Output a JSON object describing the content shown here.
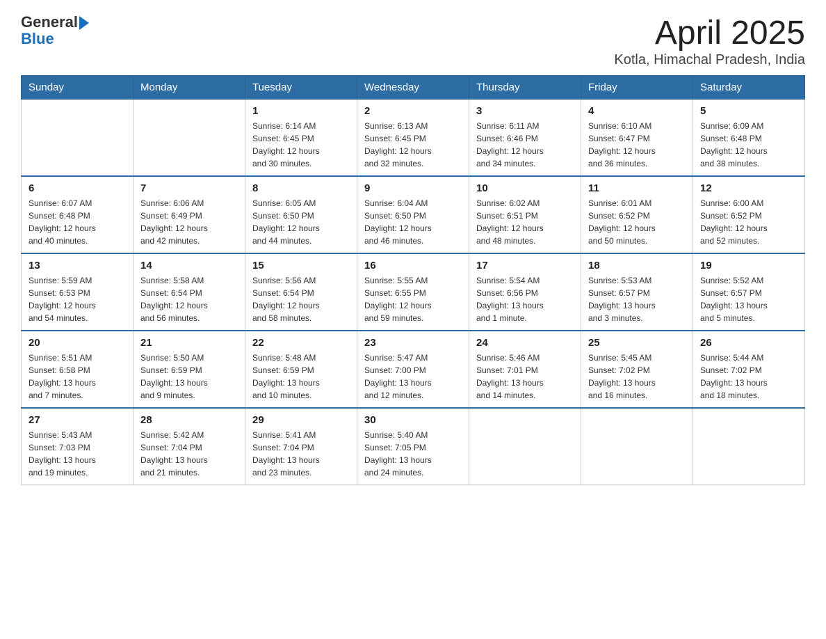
{
  "header": {
    "logo_text_general": "General",
    "logo_text_blue": "Blue",
    "title": "April 2025",
    "subtitle": "Kotla, Himachal Pradesh, India"
  },
  "calendar": {
    "days_of_week": [
      "Sunday",
      "Monday",
      "Tuesday",
      "Wednesday",
      "Thursday",
      "Friday",
      "Saturday"
    ],
    "weeks": [
      [
        {
          "day": "",
          "info": ""
        },
        {
          "day": "",
          "info": ""
        },
        {
          "day": "1",
          "info": "Sunrise: 6:14 AM\nSunset: 6:45 PM\nDaylight: 12 hours\nand 30 minutes."
        },
        {
          "day": "2",
          "info": "Sunrise: 6:13 AM\nSunset: 6:45 PM\nDaylight: 12 hours\nand 32 minutes."
        },
        {
          "day": "3",
          "info": "Sunrise: 6:11 AM\nSunset: 6:46 PM\nDaylight: 12 hours\nand 34 minutes."
        },
        {
          "day": "4",
          "info": "Sunrise: 6:10 AM\nSunset: 6:47 PM\nDaylight: 12 hours\nand 36 minutes."
        },
        {
          "day": "5",
          "info": "Sunrise: 6:09 AM\nSunset: 6:48 PM\nDaylight: 12 hours\nand 38 minutes."
        }
      ],
      [
        {
          "day": "6",
          "info": "Sunrise: 6:07 AM\nSunset: 6:48 PM\nDaylight: 12 hours\nand 40 minutes."
        },
        {
          "day": "7",
          "info": "Sunrise: 6:06 AM\nSunset: 6:49 PM\nDaylight: 12 hours\nand 42 minutes."
        },
        {
          "day": "8",
          "info": "Sunrise: 6:05 AM\nSunset: 6:50 PM\nDaylight: 12 hours\nand 44 minutes."
        },
        {
          "day": "9",
          "info": "Sunrise: 6:04 AM\nSunset: 6:50 PM\nDaylight: 12 hours\nand 46 minutes."
        },
        {
          "day": "10",
          "info": "Sunrise: 6:02 AM\nSunset: 6:51 PM\nDaylight: 12 hours\nand 48 minutes."
        },
        {
          "day": "11",
          "info": "Sunrise: 6:01 AM\nSunset: 6:52 PM\nDaylight: 12 hours\nand 50 minutes."
        },
        {
          "day": "12",
          "info": "Sunrise: 6:00 AM\nSunset: 6:52 PM\nDaylight: 12 hours\nand 52 minutes."
        }
      ],
      [
        {
          "day": "13",
          "info": "Sunrise: 5:59 AM\nSunset: 6:53 PM\nDaylight: 12 hours\nand 54 minutes."
        },
        {
          "day": "14",
          "info": "Sunrise: 5:58 AM\nSunset: 6:54 PM\nDaylight: 12 hours\nand 56 minutes."
        },
        {
          "day": "15",
          "info": "Sunrise: 5:56 AM\nSunset: 6:54 PM\nDaylight: 12 hours\nand 58 minutes."
        },
        {
          "day": "16",
          "info": "Sunrise: 5:55 AM\nSunset: 6:55 PM\nDaylight: 12 hours\nand 59 minutes."
        },
        {
          "day": "17",
          "info": "Sunrise: 5:54 AM\nSunset: 6:56 PM\nDaylight: 13 hours\nand 1 minute."
        },
        {
          "day": "18",
          "info": "Sunrise: 5:53 AM\nSunset: 6:57 PM\nDaylight: 13 hours\nand 3 minutes."
        },
        {
          "day": "19",
          "info": "Sunrise: 5:52 AM\nSunset: 6:57 PM\nDaylight: 13 hours\nand 5 minutes."
        }
      ],
      [
        {
          "day": "20",
          "info": "Sunrise: 5:51 AM\nSunset: 6:58 PM\nDaylight: 13 hours\nand 7 minutes."
        },
        {
          "day": "21",
          "info": "Sunrise: 5:50 AM\nSunset: 6:59 PM\nDaylight: 13 hours\nand 9 minutes."
        },
        {
          "day": "22",
          "info": "Sunrise: 5:48 AM\nSunset: 6:59 PM\nDaylight: 13 hours\nand 10 minutes."
        },
        {
          "day": "23",
          "info": "Sunrise: 5:47 AM\nSunset: 7:00 PM\nDaylight: 13 hours\nand 12 minutes."
        },
        {
          "day": "24",
          "info": "Sunrise: 5:46 AM\nSunset: 7:01 PM\nDaylight: 13 hours\nand 14 minutes."
        },
        {
          "day": "25",
          "info": "Sunrise: 5:45 AM\nSunset: 7:02 PM\nDaylight: 13 hours\nand 16 minutes."
        },
        {
          "day": "26",
          "info": "Sunrise: 5:44 AM\nSunset: 7:02 PM\nDaylight: 13 hours\nand 18 minutes."
        }
      ],
      [
        {
          "day": "27",
          "info": "Sunrise: 5:43 AM\nSunset: 7:03 PM\nDaylight: 13 hours\nand 19 minutes."
        },
        {
          "day": "28",
          "info": "Sunrise: 5:42 AM\nSunset: 7:04 PM\nDaylight: 13 hours\nand 21 minutes."
        },
        {
          "day": "29",
          "info": "Sunrise: 5:41 AM\nSunset: 7:04 PM\nDaylight: 13 hours\nand 23 minutes."
        },
        {
          "day": "30",
          "info": "Sunrise: 5:40 AM\nSunset: 7:05 PM\nDaylight: 13 hours\nand 24 minutes."
        },
        {
          "day": "",
          "info": ""
        },
        {
          "day": "",
          "info": ""
        },
        {
          "day": "",
          "info": ""
        }
      ]
    ]
  }
}
